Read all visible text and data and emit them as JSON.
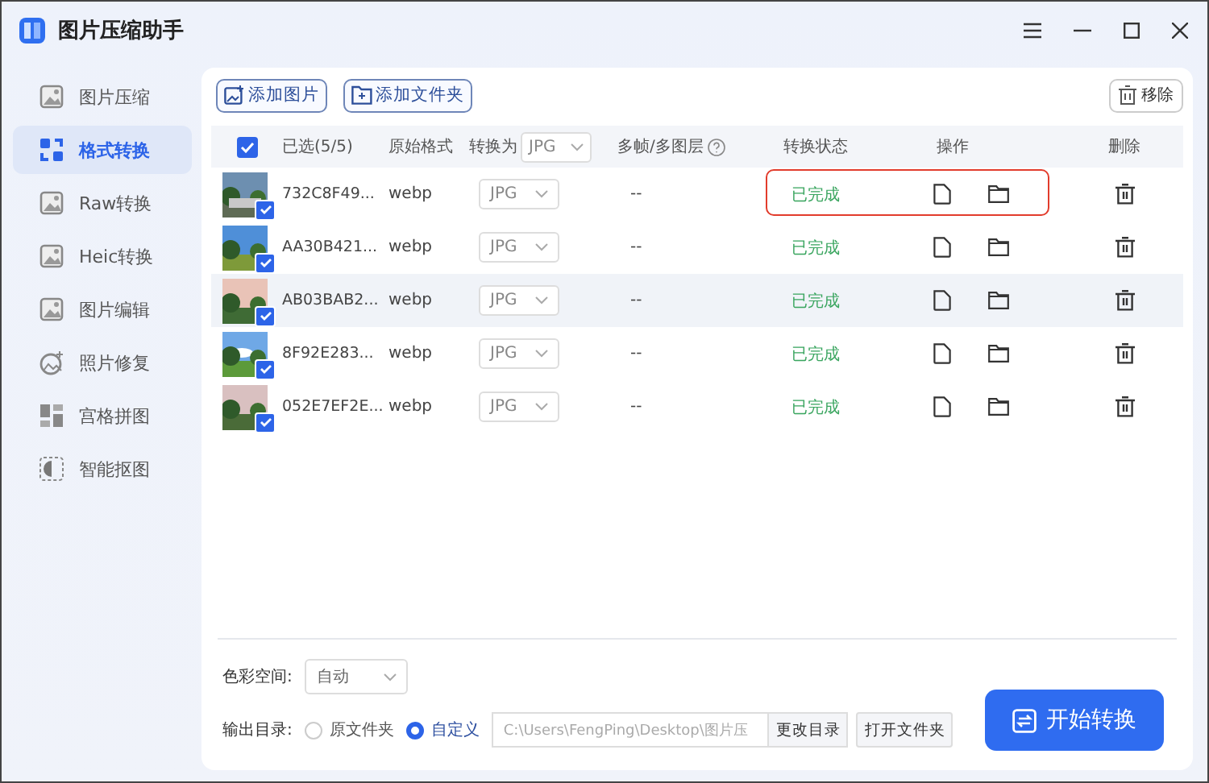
{
  "app": {
    "title": "图片压缩助手"
  },
  "sidebar": {
    "items": [
      {
        "label": "图片压缩",
        "kind": "compress",
        "selected": false
      },
      {
        "label": "格式转换",
        "kind": "convert",
        "selected": true
      },
      {
        "label": "Raw转换",
        "kind": "raw",
        "selected": false
      },
      {
        "label": "Heic转换",
        "kind": "heic",
        "selected": false
      },
      {
        "label": "图片编辑",
        "kind": "edit",
        "selected": false
      },
      {
        "label": "照片修复",
        "kind": "repair",
        "selected": false
      },
      {
        "label": "宫格拼图",
        "kind": "grid",
        "selected": false
      },
      {
        "label": "智能抠图",
        "kind": "cutout",
        "selected": false
      }
    ]
  },
  "toolbar": {
    "add_image": "添加图片",
    "add_folder": "添加文件夹",
    "remove": "移除"
  },
  "table": {
    "select_all": true,
    "columns": [
      "已选(5/5)",
      "原始格式",
      "转换为",
      "多帧/多图层",
      "转换状态",
      "操作",
      "删除"
    ],
    "header_target": "JPG",
    "rows": [
      {
        "name": "732C8F49...",
        "format": "webp",
        "target": "JPG",
        "frames": "--",
        "status": "已完成",
        "checked": true,
        "hovered": false,
        "highlighted": true
      },
      {
        "name": "AA30B421...",
        "format": "webp",
        "target": "JPG",
        "frames": "--",
        "status": "已完成",
        "checked": true,
        "hovered": false,
        "highlighted": false
      },
      {
        "name": "AB03BAB2...",
        "format": "webp",
        "target": "JPG",
        "frames": "--",
        "status": "已完成",
        "checked": true,
        "hovered": true,
        "highlighted": false
      },
      {
        "name": "8F92E283...",
        "format": "webp",
        "target": "JPG",
        "frames": "--",
        "status": "已完成",
        "checked": true,
        "hovered": false,
        "highlighted": false
      },
      {
        "name": "052E7EF2E...",
        "format": "webp",
        "target": "JPG",
        "frames": "--",
        "status": "已完成",
        "checked": true,
        "hovered": false,
        "highlighted": false
      }
    ]
  },
  "settings": {
    "color_space_label": "色彩空间:",
    "color_space": "自动",
    "output_label": "输出目录:",
    "options": [
      {
        "label": "原文件夹",
        "selected": false
      },
      {
        "label": "自定义",
        "selected": true
      }
    ],
    "path": "C:\\Users\\FengPing\\Desktop\\图片压",
    "change_dir": "更改目录",
    "open_folder": "打开文件夹",
    "start": "开始转换"
  }
}
